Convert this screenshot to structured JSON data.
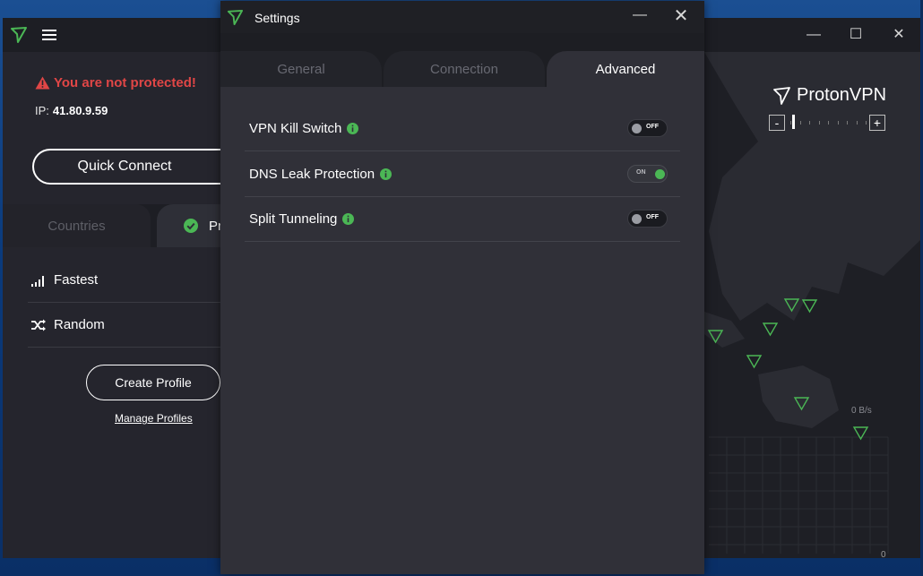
{
  "main": {
    "status": "You are not protected!",
    "ip_label": "IP:",
    "ip_value": "41.80.9.59",
    "quick_connect": "Quick Connect",
    "tabs": {
      "countries": "Countries",
      "profiles_partial": "Pr"
    },
    "list": [
      {
        "label": "Fastest",
        "icon": "signal-bars-icon"
      },
      {
        "label": "Random",
        "icon": "shuffle-icon"
      }
    ],
    "create_profile": "Create Profile",
    "manage_profiles": "Manage Profiles"
  },
  "map": {
    "brand": "ProtonVPN",
    "speed_label": "0 B/s",
    "graph_zero": "0",
    "zoom": {
      "minus": "-",
      "plus": "+"
    }
  },
  "settings": {
    "title": "Settings",
    "tabs": [
      "General",
      "Connection",
      "Advanced"
    ],
    "active_tab": "Advanced",
    "rows": [
      {
        "label": "VPN Kill Switch",
        "state": "OFF"
      },
      {
        "label": "DNS Leak Protection",
        "state": "ON"
      },
      {
        "label": "Split Tunneling",
        "state": "OFF"
      }
    ]
  },
  "colors": {
    "accent_green": "#4bb755",
    "danger_red": "#e04646",
    "window_bg": "#303038",
    "titlebar_bg": "#1f2025"
  }
}
